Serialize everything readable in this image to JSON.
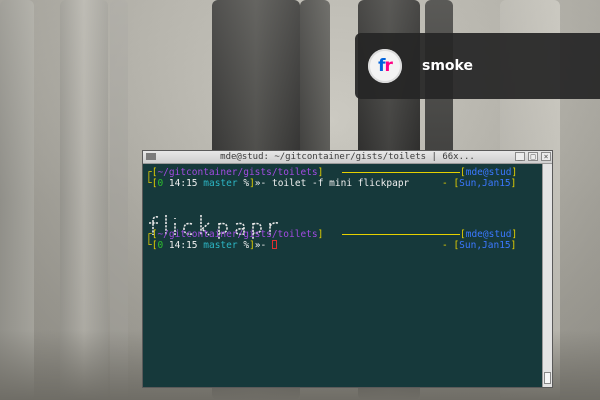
{
  "notification": {
    "icon": "flickr-icon",
    "icon_letters": [
      "f",
      "r"
    ],
    "title": "smoke"
  },
  "terminal": {
    "window_title": "mde@stud: ~/gitcontainer/gists/toilets | 66x...",
    "scroll_position_fraction": 1.0,
    "prompt1": {
      "path": "~/gitcontainer/gists/toilets",
      "user_host": "mde@stud",
      "status_num": "0",
      "time": "14:15",
      "branch": "master",
      "branch_flag": "%",
      "arrow": "»-",
      "command": "toilet -f mini flickpapr",
      "date": "Sun,Jan15"
    },
    "banner_text": "flickpapr",
    "prompt2": {
      "path": "~/gitcontainer/gists/toilets",
      "user_host": "mde@stud",
      "status_num": "0",
      "time": "14:15",
      "branch": "master",
      "branch_flag": "%",
      "arrow": "»-",
      "date": "Sun,Jan15"
    }
  },
  "colors": {
    "terminal_bg": "#16393b",
    "prompt_yellow": "#e5d100",
    "path_purple": "#a14be0",
    "host_blue": "#3b78ff",
    "status_green": "#2ec12e",
    "branch_cyan": "#2cb5c4",
    "cursor_red": "#e03030"
  }
}
